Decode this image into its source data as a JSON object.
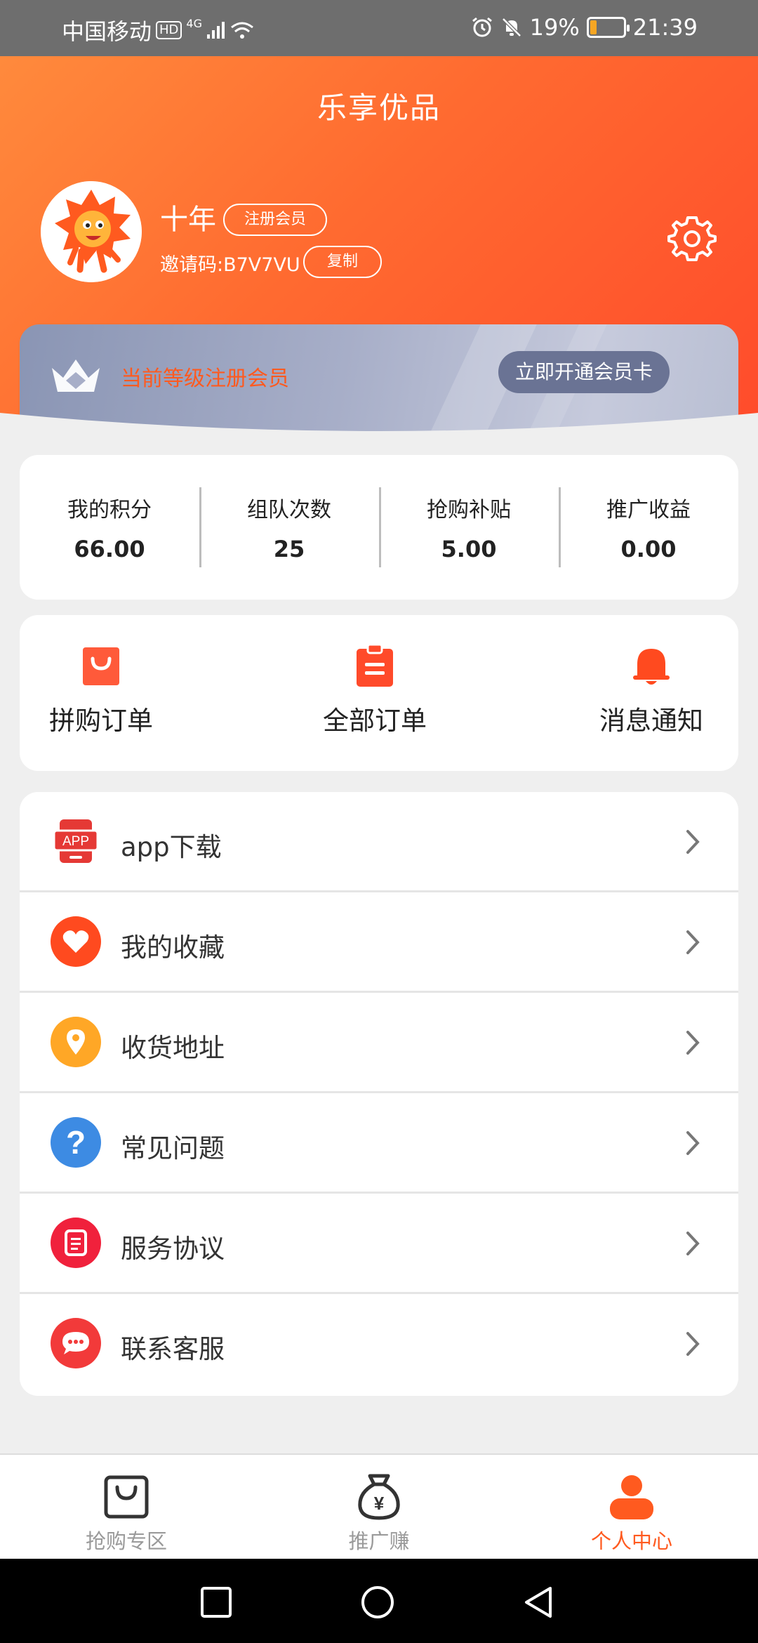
{
  "status_bar": {
    "carrier": "中国移动",
    "hd": "HD",
    "network": "4G",
    "battery_percent": "19%",
    "battery_level": 0.19,
    "time": "21:39"
  },
  "header": {
    "title": "乐享优品",
    "username": "十年",
    "member_badge": "注册会员",
    "invite_code": "邀请码:B7V7VU",
    "copy_label": "复制"
  },
  "vip_card": {
    "level_text": "当前等级注册会员",
    "open_button": "立即开通会员卡"
  },
  "stats": [
    {
      "label": "我的积分",
      "value": "66.00"
    },
    {
      "label": "组队次数",
      "value": "25"
    },
    {
      "label": "抢购补贴",
      "value": "5.00"
    },
    {
      "label": "推广收益",
      "value": "0.00"
    }
  ],
  "quick_actions": [
    {
      "label": "拼购订单",
      "icon": "shopping-bag-icon"
    },
    {
      "label": "全部订单",
      "icon": "clipboard-icon"
    },
    {
      "label": "消息通知",
      "icon": "bell-icon"
    }
  ],
  "menu": [
    {
      "label": "app下载",
      "icon": "app-download-icon",
      "icon_text": "APP",
      "color": "#e53935"
    },
    {
      "label": "我的收藏",
      "icon": "heart-icon",
      "color": "#ff4a1f"
    },
    {
      "label": "收货地址",
      "icon": "location-pin-icon",
      "color": "#ffa726"
    },
    {
      "label": "常见问题",
      "icon": "question-icon",
      "icon_text": "?",
      "color": "#3d8be3"
    },
    {
      "label": "服务协议",
      "icon": "document-icon",
      "color": "#f0213c"
    },
    {
      "label": "联系客服",
      "icon": "chat-bubble-icon",
      "color": "#f23a3a"
    }
  ],
  "tabbar": [
    {
      "label": "抢购专区",
      "icon": "shopping-bag-outline-icon",
      "active": false
    },
    {
      "label": "推广赚",
      "icon": "money-bag-icon",
      "icon_text": "¥",
      "active": false
    },
    {
      "label": "个人中心",
      "icon": "person-icon",
      "active": true
    }
  ],
  "colors": {
    "accent": "#ff5a1f",
    "tab_active": "#ff5a1f",
    "tab_inactive": "#9a9a9a"
  }
}
